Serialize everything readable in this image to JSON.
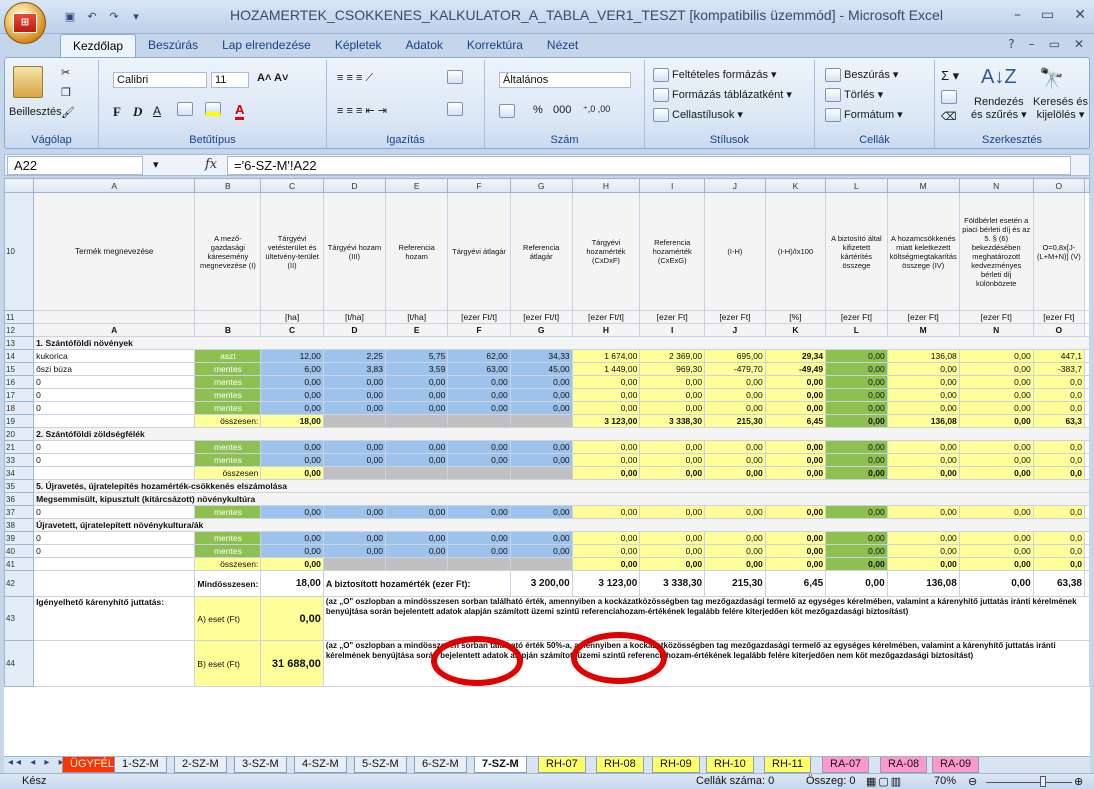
{
  "window": {
    "title": "HOZAMERTEK_CSOKKENES_KALKULATOR_A_TABLA_VER1_TESZT  [kompatibilis üzemmód]  -  Microsoft Excel"
  },
  "ribbon": {
    "tabs": [
      "Kezdőlap",
      "Beszúrás",
      "Lap elrendezése",
      "Képletek",
      "Adatok",
      "Korrektúra",
      "Nézet"
    ],
    "groups": {
      "clipboard": {
        "label": "Vágólap",
        "paste": "Beillesztés"
      },
      "font": {
        "label": "Betűtípus",
        "font_name": "Calibri",
        "font_size": "11",
        "bold": "F",
        "italic": "D",
        "underline": "A"
      },
      "alignment": {
        "label": "Igazítás"
      },
      "number": {
        "label": "Szám",
        "format": "Általános",
        "percent": "%",
        "thousands": "000"
      },
      "styles": {
        "label": "Stílusok",
        "cond": "Feltételes formázás",
        "table": "Formázás táblázatként",
        "cell": "Cellastílusok"
      },
      "cells": {
        "label": "Cellák",
        "insert": "Beszúrás",
        "delete": "Törlés",
        "format": "Formátum"
      },
      "editing": {
        "label": "Szerkesztés",
        "sort": "Rendezés",
        "sort2": "és szűrés",
        "find": "Keresés és",
        "find2": "kijelölés"
      }
    }
  },
  "formula_bar": {
    "name_box": "A22",
    "fx": "fx",
    "formula": "='6-SZ-M'!A22"
  },
  "columns": [
    "A",
    "B",
    "C",
    "D",
    "E",
    "F",
    "G",
    "H",
    "I",
    "J",
    "K",
    "L",
    "M",
    "N",
    "O"
  ],
  "header_rows": {
    "r10": [
      "Termék megnevezése",
      "A mező-gazdasági káresemény megnevezése (I)",
      "Tárgyévi vetésterület és ültetvény-terület (II)",
      "Tárgyévi hozam (III)",
      "Referencia hozam",
      "Tárgyévi átlagár",
      "Referencia átlagár",
      "Tárgyévi hozamérték (CxDxF)",
      "Referencia hozamérték (CxExG)",
      "(I-H)",
      "(I-H)/Ix100",
      "A biztosító által kifizetett kártérítés összege",
      "A hozamcsökkenés miatt keletkezett költségmegtakarítás összege (IV)",
      "Földbérlet esetén a piaci bérleti díj és az 5. § (6) bekezdésében meghatározott kedvezményes bérleti díj különbözete",
      "O=0,8x[J-(L+M+N)] (V)"
    ],
    "r11": [
      "",
      "",
      "[ha]",
      "[t/ha]",
      "[t/ha]",
      "[ezer Ft/t]",
      "[ezer Ft/t]",
      "[ezer Ft/t]",
      "[ezer Ft]",
      "[ezer Ft]",
      "[%]",
      "[ezer Ft]",
      "[ezer Ft]",
      "[ezer Ft]",
      "[ezer Ft]"
    ],
    "r12": [
      "A",
      "B",
      "C",
      "D",
      "E",
      "F",
      "G",
      "H",
      "I",
      "J",
      "K",
      "L",
      "M",
      "N",
      "O"
    ]
  },
  "rows": {
    "r13": "1. Szántóföldi növények",
    "r14": [
      "kukorica",
      "aszt",
      "12,00",
      "2,25",
      "5,75",
      "62,00",
      "34,33",
      "1 674,00",
      "2 369,00",
      "695,00",
      "29,34",
      "0,00",
      "136,08",
      "0,00",
      "447,1"
    ],
    "r15": [
      "őszi búza",
      "mentes",
      "6,00",
      "3,83",
      "3,59",
      "63,00",
      "45,00",
      "1 449,00",
      "969,30",
      "-479,70",
      "-49,49",
      "0,00",
      "0,00",
      "0,00",
      "-383,7"
    ],
    "r16": [
      "0",
      "mentes",
      "0,00",
      "0,00",
      "0,00",
      "0,00",
      "0,00",
      "0,00",
      "0,00",
      "0,00",
      "0,00",
      "0,00",
      "0,00",
      "0,00",
      "0,0"
    ],
    "r17": [
      "0",
      "mentes",
      "0,00",
      "0,00",
      "0,00",
      "0,00",
      "0,00",
      "0,00",
      "0,00",
      "0,00",
      "0,00",
      "0,00",
      "0,00",
      "0,00",
      "0,0"
    ],
    "r18": [
      "0",
      "mentes",
      "0,00",
      "0,00",
      "0,00",
      "0,00",
      "0,00",
      "0,00",
      "0,00",
      "0,00",
      "0,00",
      "0,00",
      "0,00",
      "0,00",
      "0,0"
    ],
    "r19": [
      "",
      "összesen:",
      "18,00",
      "",
      "",
      "",
      "",
      "3 123,00",
      "3 338,30",
      "215,30",
      "6,45",
      "0,00",
      "136,08",
      "0,00",
      "63,3"
    ],
    "r20": "2. Szántóföldi zöldségfélék",
    "r21": [
      "0",
      "mentes",
      "0,00",
      "0,00",
      "0,00",
      "0,00",
      "0,00",
      "0,00",
      "0,00",
      "0,00",
      "0,00",
      "0,00",
      "0,00",
      "0,00",
      "0,0"
    ],
    "r33": [
      "0",
      "mentes",
      "0,00",
      "0,00",
      "0,00",
      "0,00",
      "0,00",
      "0,00",
      "0,00",
      "0,00",
      "0,00",
      "0,00",
      "0,00",
      "0,00",
      "0,0"
    ],
    "r34": [
      "",
      "összesen",
      "0,00",
      "",
      "",
      "",
      "",
      "0,00",
      "0,00",
      "0,00",
      "0,00",
      "0,00",
      "0,00",
      "0,00",
      "0,0"
    ],
    "r35": "5. Újravetés, újratelepítés hozamérték-csökkenés elszámolása",
    "r36": "Megsemmisült, kipusztult (kitárcsázott) növénykultúra",
    "r37": [
      "0",
      "mentes",
      "0,00",
      "0,00",
      "0,00",
      "0,00",
      "0,00",
      "0,00",
      "0,00",
      "0,00",
      "0,00",
      "0,00",
      "0,00",
      "0,00",
      "0,0"
    ],
    "r38": "Újravetett, újratelepített növénykultura/ák",
    "r39": [
      "0",
      "mentes",
      "0,00",
      "0,00",
      "0,00",
      "0,00",
      "0,00",
      "0,00",
      "0,00",
      "0,00",
      "0,00",
      "0,00",
      "0,00",
      "0,00",
      "0,0"
    ],
    "r40": [
      "0",
      "mentes",
      "0,00",
      "0,00",
      "0,00",
      "0,00",
      "0,00",
      "0,00",
      "0,00",
      "0,00",
      "0,00",
      "0,00",
      "0,00",
      "0,00",
      "0,0"
    ],
    "r41": [
      "",
      "összesen:",
      "0,00",
      "",
      "",
      "",
      "",
      "0,00",
      "0,00",
      "0,00",
      "0,00",
      "0,00",
      "0,00",
      "0,00",
      "0,0"
    ],
    "r42": {
      "label": "Mindösszesen:",
      "c": "18,00",
      "note": "A biztosított hozamérték (ezer Ft):",
      "g": "3 200,00",
      "h": "3 123,00",
      "i": "3 338,30",
      "j": "215,30",
      "k": "6,45",
      "l": "0,00",
      "m": "136,08",
      "n": "0,00",
      "o": "63,38"
    },
    "r43": {
      "a": "Igényelhető kárenyhítő juttatás:",
      "b": "A) eset (Ft)",
      "c": "0,00",
      "text": "(az „O\" oszlopban a mindösszesen sorban található érték, amennyiben a kockázatközösségben tag mezőgazdasági termelő az egységes kérelmében, valamint a kárenyhítő juttatás iránti kérelmének benyújtása során bejelentett adatok alapján számított üzemi szintű referenciahozam-értékének legalább felére kiterjedően köt mezőgazdasági biztosítást)"
    },
    "r44": {
      "b": "B) eset (Ft)",
      "c": "31 688,00",
      "text": "(az „O\" oszlopban a mindösszesen sorban található érték 50%-a, amennyiben a kockázatközösségben tag mezőgazdasági termelő az egységes kérelmében, valamint a kárenyhítő juttatás iránti kérelmének benyújtása során bejelentett adatok alapján számított üzemi szintű referenciahozam-értékének legalább felére kiterjedően nem köt mezőgazdasági biztosítást)"
    }
  },
  "sheet_tabs": [
    "ÜGYFÉL",
    "1-SZ-M",
    "2-SZ-M",
    "3-SZ-M",
    "4-SZ-M",
    "5-SZ-M",
    "6-SZ-M",
    "7-SZ-M",
    "RH-07",
    "RH-08",
    "RH-09",
    "RH-10",
    "RH-11",
    "RA-07",
    "RA-08",
    "RA-09"
  ],
  "status": {
    "ready": "Kész",
    "count": "Cellák száma: 0",
    "sum": "Összeg: 0",
    "zoom": "70%"
  }
}
